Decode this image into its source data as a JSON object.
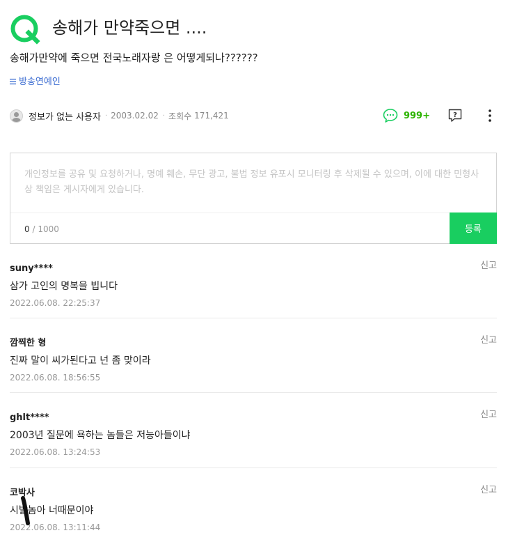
{
  "question": {
    "title": "송해가 만약죽으면 ....",
    "body": "송해가만약에 죽으면 전국노래자랑 은 어떻게되나??????",
    "category": "방송연예인",
    "category_icon": "menu-icon"
  },
  "meta": {
    "author": "정보가 없는 사용자",
    "date": "2003.02.02",
    "views_label": "조회수",
    "views": "171,421"
  },
  "actions": {
    "comment_count": "999+",
    "comment_icon": "speech-bubble-icon",
    "report_icon": "question-report-icon",
    "more_icon": "more-vertical-icon"
  },
  "comment_form": {
    "placeholder": "개인정보를 공유 및 요청하거나, 명예 훼손, 무단 광고, 불법 정보 유포시 모니터링 후 삭제될 수 있으며, 이에 대한 민형사상 책임은 게시자에게 있습니다.",
    "current": "0",
    "max": "/ 1000",
    "submit_label": "등록"
  },
  "comments": [
    {
      "author": "suny****",
      "text": "삼가 고인의 명복을 빕니다",
      "date": "2022.06.08. 22:25:37",
      "report": "신고"
    },
    {
      "author": "깜찍한 형",
      "text": "진짜 말이 씨가된다고 넌 좀 맞이라",
      "date": "2022.06.08. 18:56:55",
      "report": "신고"
    },
    {
      "author": "ghlt****",
      "text": "2003년 질문에 욕하는 놈들은 저능아들이냐",
      "date": "2022.06.08. 13:24:53",
      "report": "신고"
    },
    {
      "author": "코박사",
      "text": "시발놈아 너때문이야",
      "date": "2022.06.08. 13:11:44",
      "report": "신고"
    }
  ],
  "colors": {
    "brand_green": "#19ce60",
    "link_blue": "#3a6bd1",
    "count_green": "#2db400"
  }
}
